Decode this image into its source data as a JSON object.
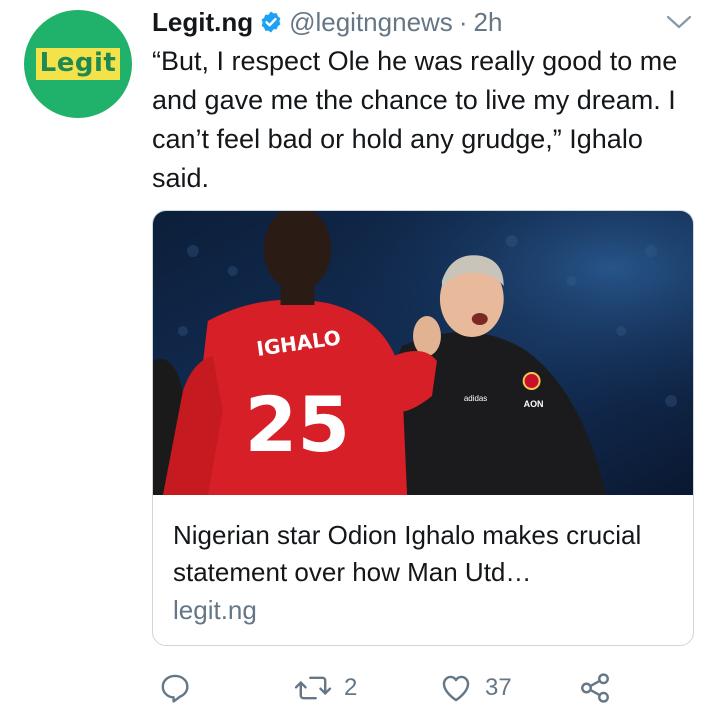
{
  "tweet": {
    "display_name": "Legit.ng",
    "handle": "@legitngnews",
    "separator": "·",
    "time": "2h",
    "avatar_text": "Legit",
    "verified_icon": "verified-badge-icon",
    "text": "“But, I respect Ole he was really good to me and gave me the chance to live my dream. I can’t feel bad or hold any grudge,” Ighalo said."
  },
  "card": {
    "image_desc_jersey_name": "IGHALO",
    "image_desc_jersey_number": "25",
    "title": "Nigerian star Odion Ighalo makes crucial statement over how Man Utd…",
    "domain": "legit.ng"
  },
  "actions": {
    "reply_icon": "reply-icon",
    "retweet_icon": "retweet-icon",
    "retweet_count": "2",
    "like_icon": "heart-icon",
    "like_count": "37",
    "share_icon": "share-icon"
  },
  "colors": {
    "accent": "#1da1f2",
    "muted": "#657786",
    "avatar_bg": "#20b26b",
    "avatar_mark": "#f4e24a"
  }
}
